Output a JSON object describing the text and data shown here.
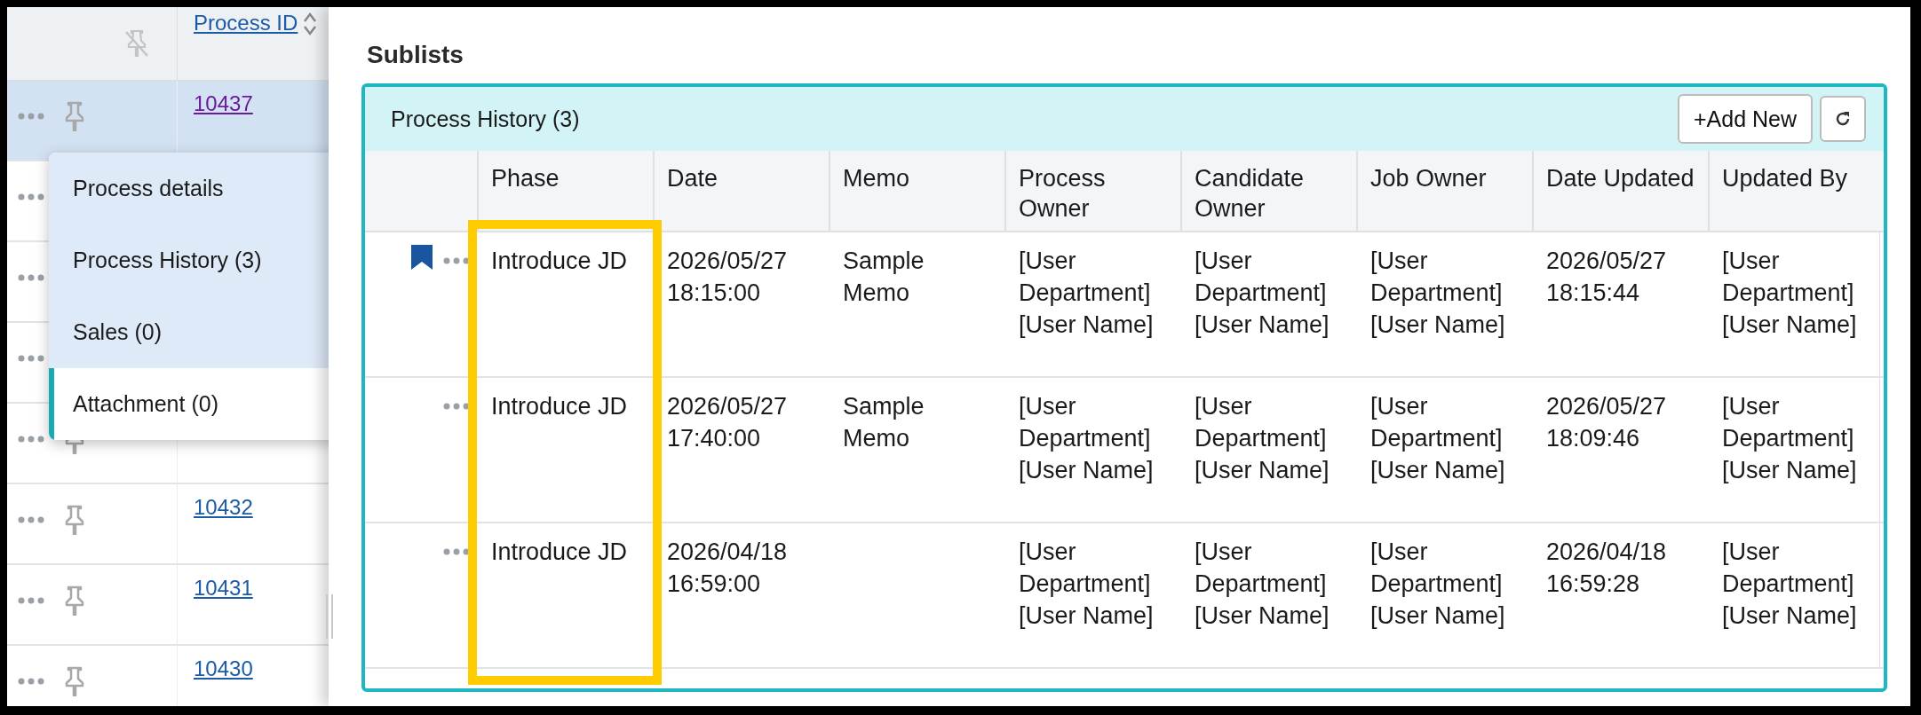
{
  "list": {
    "columns": [
      {
        "kind": "pin-toggle"
      },
      {
        "kind": "sortable",
        "label": "Process ID"
      }
    ],
    "rows": [
      {
        "kind": "record",
        "id": "10437",
        "selected": true,
        "visited": true
      },
      {
        "kind": "covered",
        "selected": false
      },
      {
        "kind": "covered",
        "selected": false
      },
      {
        "kind": "covered",
        "selected": false
      },
      {
        "kind": "record",
        "selected": false
      },
      {
        "kind": "record",
        "id": "10432",
        "selected": false,
        "visited": false
      },
      {
        "kind": "record",
        "id": "10431",
        "selected": false,
        "visited": false
      },
      {
        "kind": "record",
        "id": "10430",
        "selected": false,
        "visited": false
      }
    ]
  },
  "context_menu": {
    "items": [
      {
        "label": "Process details",
        "selected": false
      },
      {
        "label": "Process History (3)",
        "selected": false
      },
      {
        "label": "Sales (0)",
        "selected": false
      },
      {
        "label": "Attachment (0)",
        "selected": true
      }
    ]
  },
  "drawer": {
    "title": "Sublists",
    "panel": {
      "title": "Process History (3)",
      "buttons": [
        {
          "kind": "text",
          "label": "+Add New"
        },
        {
          "kind": "refresh"
        }
      ],
      "columns": [
        "Phase",
        "Date",
        "Memo",
        "Process Owner",
        "Candidate Owner",
        "Job Owner",
        "Date Updated",
        "Updated By"
      ],
      "rows": [
        {
          "bookmarked": true,
          "cells": [
            "Introduce JD",
            "2026/05/27 18:15:00",
            "Sample Memo",
            "[User Department] [User Name]",
            "[User Department] [User Name]",
            "[User Department] [User Name]",
            "2026/05/27 18:15:44",
            "[User Department] [User Name]"
          ]
        },
        {
          "bookmarked": false,
          "cells": [
            "Introduce JD",
            "2026/05/27 17:40:00",
            "Sample Memo",
            "[User Department] [User Name]",
            "[User Department] [User Name]",
            "[User Department] [User Name]",
            "2026/05/27 18:09:46",
            "[User Department] [User Name]"
          ]
        },
        {
          "bookmarked": false,
          "cells": [
            "Introduce JD",
            "2026/04/18 16:59:00",
            null,
            "[User Department] [User Name]",
            "[User Department] [User Name]",
            "[User Department] [User Name]",
            "2026/04/18 16:59:28",
            "[User Department] [User Name]"
          ]
        }
      ]
    }
  }
}
